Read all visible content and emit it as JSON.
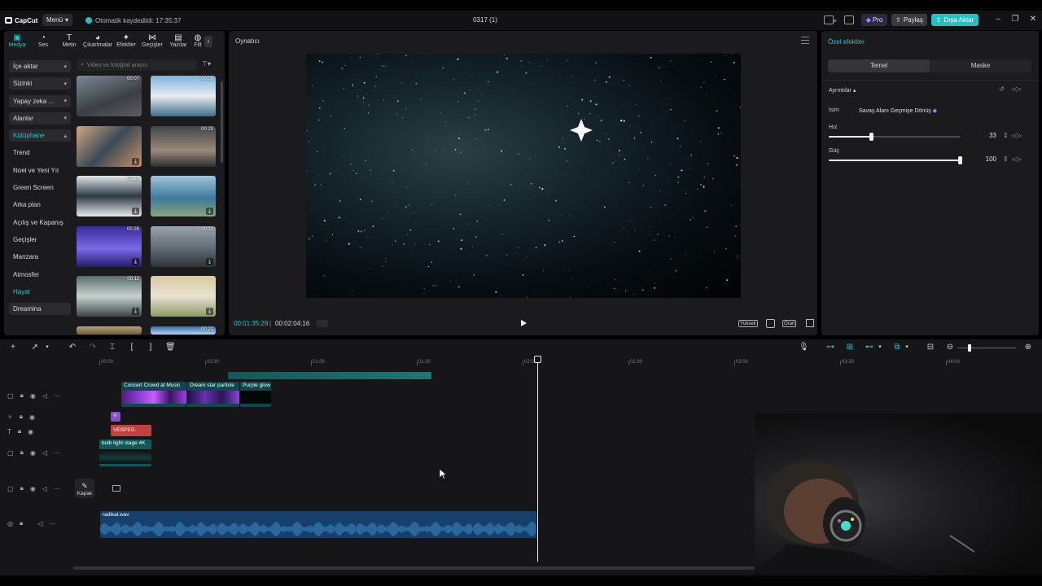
{
  "app": {
    "logo": "CapCut",
    "menu_label": "Menü",
    "autosave": "Otomatik kaydedildi: 17:35:37",
    "project_title": "0317 (1)",
    "pro_label": "Pro",
    "share_label": "Paylaş",
    "export_label": "Dışa Aktar",
    "accent": "#22c6c9"
  },
  "left_panel": {
    "tabs": [
      {
        "label": "Medya",
        "icon": "media-icon"
      },
      {
        "label": "Ses",
        "icon": "audio-icon"
      },
      {
        "label": "Metin",
        "icon": "text-icon"
      },
      {
        "label": "Çıkartmalar",
        "icon": "sticker-icon"
      },
      {
        "label": "Efektler",
        "icon": "effects-icon"
      },
      {
        "label": "Geçişler",
        "icon": "transitions-icon"
      },
      {
        "label": "Yazılar",
        "icon": "captions-icon"
      },
      {
        "label": "Filt",
        "icon": "filters-icon"
      }
    ],
    "categories": [
      {
        "label": "İçe aktar",
        "boxed": true,
        "chevron": "▾"
      },
      {
        "label": "Sizinki",
        "boxed": true,
        "chevron": "▾"
      },
      {
        "label": "Yapay zeka ...",
        "boxed": true,
        "chevron": "▾"
      },
      {
        "label": "Alanlar",
        "boxed": true,
        "chevron": "▾"
      },
      {
        "label": "Kütüphane",
        "boxed": true,
        "chevron": "▴",
        "teal": true
      },
      {
        "label": "Trend"
      },
      {
        "label": "Noel ve Yeni Yıl"
      },
      {
        "label": "Green Screen"
      },
      {
        "label": "Arka plan"
      },
      {
        "label": "Açılış ve Kapanış"
      },
      {
        "label": "Geçişler"
      },
      {
        "label": "Manzara"
      },
      {
        "label": "Atmosfer"
      },
      {
        "label": "Hayat",
        "teal": true
      },
      {
        "label": "Dreamina",
        "boxed": true
      }
    ],
    "search_placeholder": "Video ve fotoğraf arayın",
    "filter_label": "⊤▾",
    "thumbnails": [
      {
        "duration": "00:07",
        "download": false
      },
      {
        "duration": "00:09",
        "download": false
      },
      {
        "duration": "",
        "download": true
      },
      {
        "duration": "00:29",
        "download": false
      },
      {
        "duration": "00:21",
        "download": true
      },
      {
        "duration": "",
        "download": true
      },
      {
        "duration": "00:26",
        "download": true
      },
      {
        "duration": "00:11",
        "download": true
      },
      {
        "duration": "00:11",
        "download": true
      },
      {
        "duration": "",
        "download": true
      },
      {
        "duration": "",
        "download": false
      },
      {
        "duration": "00:22",
        "download": false
      }
    ]
  },
  "player": {
    "title": "Oynatıcı",
    "time_current": "00:01:35:29",
    "time_total": "00:02:04:16",
    "quality": "Yüksek",
    "ratio": "Oran"
  },
  "right_panel": {
    "title": "Özel efektler",
    "tabs": [
      "Temel",
      "Maske"
    ],
    "details": "Ayrıntılar ▴",
    "name_label": "İsim",
    "name_value": "Savaş Alanı Geçmişe Dönüş",
    "speed_label": "Hız",
    "speed_value": "33",
    "speed_fraction": 0.33,
    "power_label": "Güç",
    "power_value": "100",
    "power_fraction": 1.0
  },
  "timeline": {
    "ruler": [
      "00:00",
      "00:30",
      "01:00",
      "01:30",
      "02:00",
      "02:30",
      "03:00",
      "03:30",
      "04:00"
    ],
    "clips": {
      "concert": "Concert Crowd at Music",
      "dream": "Dream star particle",
      "purple": "Purple glow",
      "text": "VESPEG",
      "bulb": "bulb light stage 4K",
      "audio": "radikal.wav"
    },
    "cover_label": "Kapak"
  }
}
